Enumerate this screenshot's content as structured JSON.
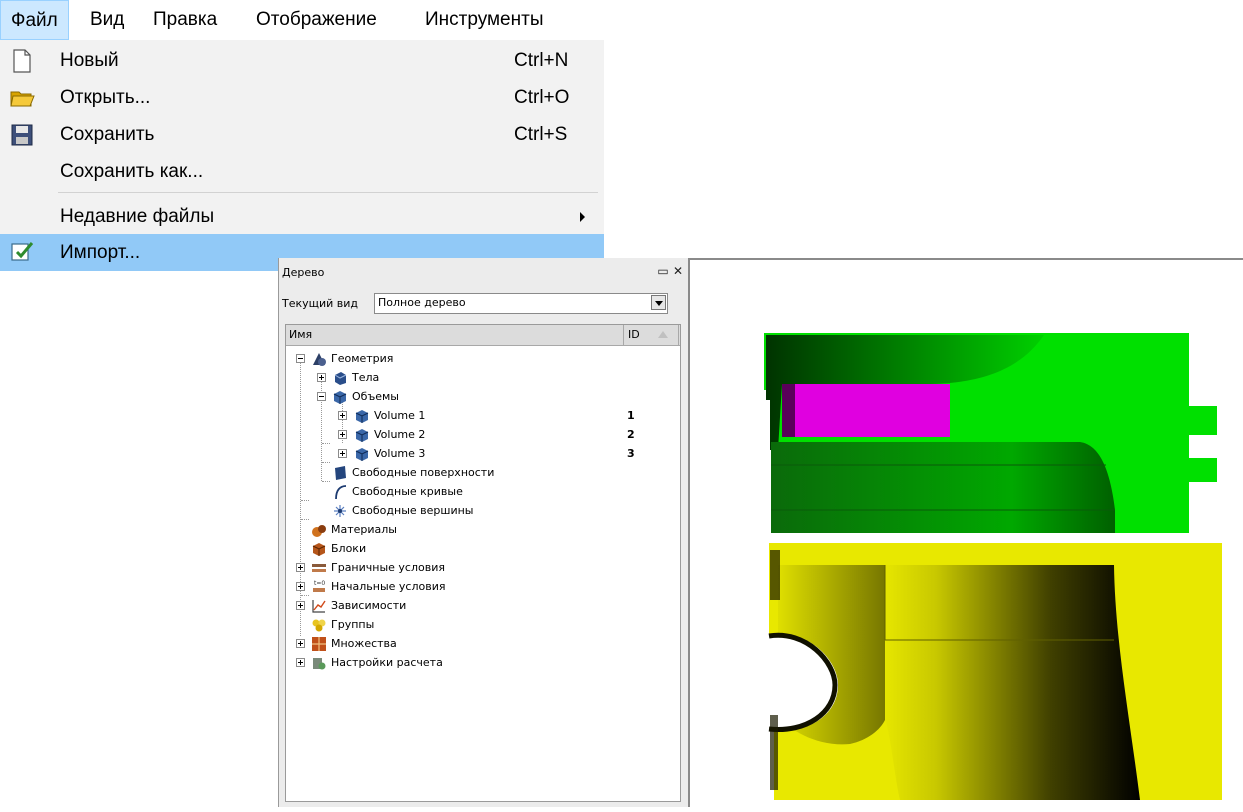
{
  "menubar": {
    "items": [
      "Файл",
      "Вид",
      "Правка",
      "Отображение",
      "Инструменты"
    ]
  },
  "file_menu": {
    "items": [
      {
        "label": "Новый",
        "shortcut": "Ctrl+N",
        "icon": "new-file-icon"
      },
      {
        "label": "Открыть...",
        "shortcut": "Ctrl+O",
        "icon": "folder-icon"
      },
      {
        "label": "Сохранить",
        "shortcut": "Ctrl+S",
        "icon": "floppy-disk-icon"
      },
      {
        "label": "Сохранить как...",
        "shortcut": "",
        "icon": ""
      },
      {
        "label": "Недавние файлы",
        "shortcut": "",
        "icon": "",
        "submenu": true
      },
      {
        "label": "Импорт...",
        "shortcut": "",
        "icon": "import-icon",
        "highlighted": true
      }
    ]
  },
  "tree_panel": {
    "title": "Дерево",
    "current_view_label": "Текущий вид",
    "current_view_value": "Полное дерево",
    "col_name": "Имя",
    "col_id": "ID",
    "rows": [
      {
        "label": "Геометрия",
        "id": "",
        "icon": "geometry-icon"
      },
      {
        "label": "Тела",
        "id": "",
        "icon": "bodies-icon"
      },
      {
        "label": "Объемы",
        "id": "",
        "icon": "volumes-icon"
      },
      {
        "label": "Volume 1",
        "id": "1",
        "icon": "volume-icon"
      },
      {
        "label": "Volume 2",
        "id": "2",
        "icon": "volume-icon"
      },
      {
        "label": "Volume 3",
        "id": "3",
        "icon": "volume-icon"
      },
      {
        "label": "Свободные поверхности",
        "id": "",
        "icon": "surface-icon"
      },
      {
        "label": "Свободные кривые",
        "id": "",
        "icon": "curve-icon"
      },
      {
        "label": "Свободные вершины",
        "id": "",
        "icon": "vertex-icon"
      },
      {
        "label": "Материалы",
        "id": "",
        "icon": "materials-icon"
      },
      {
        "label": "Блоки",
        "id": "",
        "icon": "blocks-icon"
      },
      {
        "label": "Граничные условия",
        "id": "",
        "icon": "boundary-conditions-icon"
      },
      {
        "label": "Начальные условия",
        "id": "",
        "icon": "initial-conditions-icon"
      },
      {
        "label": "Зависимости",
        "id": "",
        "icon": "dependencies-icon"
      },
      {
        "label": "Группы",
        "id": "",
        "icon": "groups-icon"
      },
      {
        "label": "Множества",
        "id": "",
        "icon": "sets-icon"
      },
      {
        "label": "Настройки расчета",
        "id": "",
        "icon": "calc-settings-icon"
      }
    ]
  },
  "viewport": {
    "colors": {
      "green": "#00e000",
      "magenta": "#e000e0",
      "yellow": "#e8e800"
    }
  }
}
